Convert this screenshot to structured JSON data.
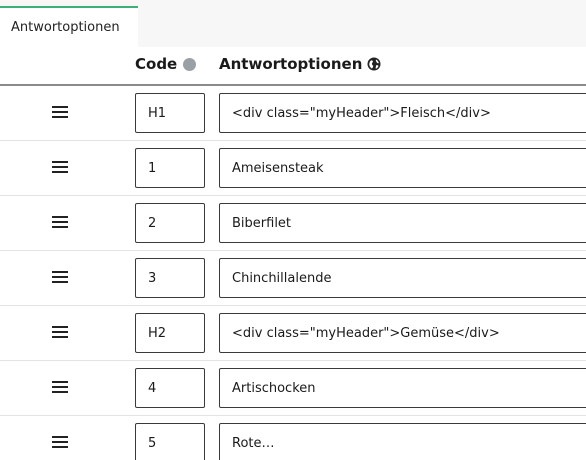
{
  "tabs": [
    {
      "label": "Antwortoptionen",
      "active": true
    }
  ],
  "header": {
    "code_label": "Code",
    "answer_label": "Antwortoptionen"
  },
  "rows": [
    {
      "code": "H1",
      "answer": "<div class=\"myHeader\">Fleisch</div>"
    },
    {
      "code": "1",
      "answer": "Ameisensteak"
    },
    {
      "code": "2",
      "answer": "Biberfilet"
    },
    {
      "code": "3",
      "answer": "Chinchillalende"
    },
    {
      "code": "H2",
      "answer": "<div class=\"myHeader\">Gemüse</div>"
    },
    {
      "code": "4",
      "answer": "Artischocken"
    },
    {
      "code": "5",
      "answer": "Rote…"
    }
  ],
  "colors": {
    "accent": "#3bb273",
    "border": "#3a3a3a"
  }
}
